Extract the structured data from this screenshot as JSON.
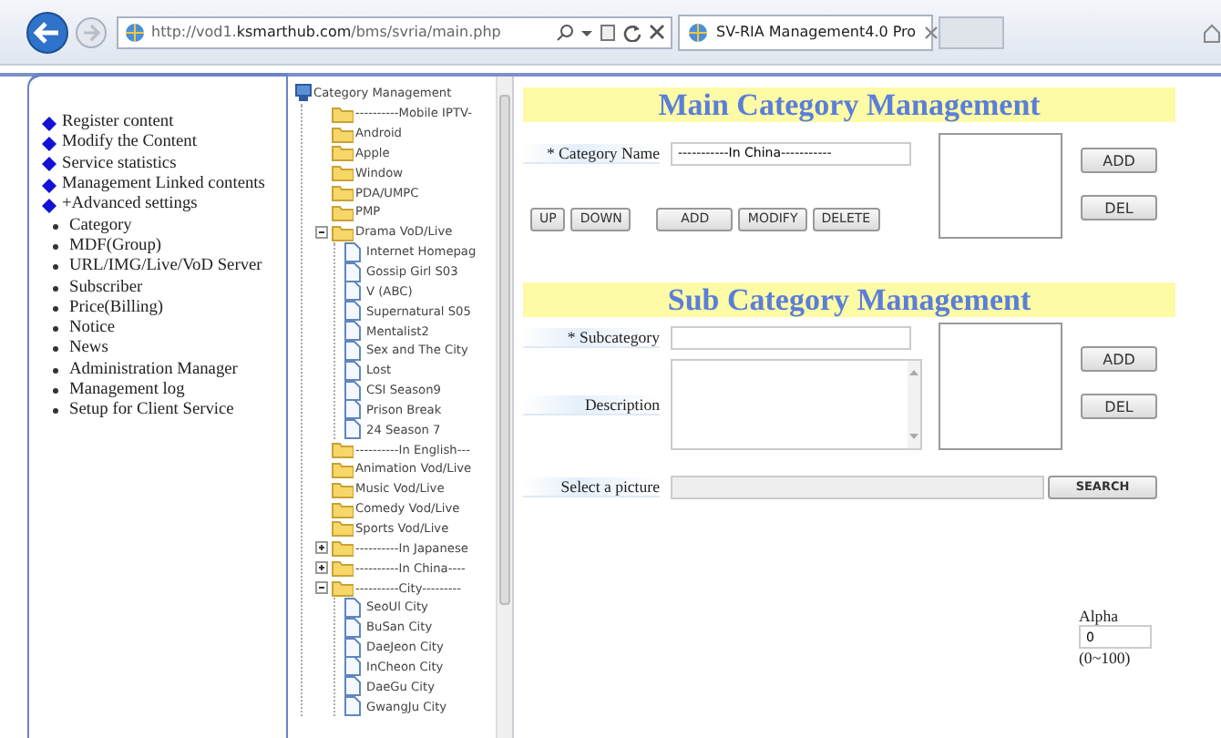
{
  "browser": {
    "url": "http://vod1.**ksmarthub.com**/bms/svria/main.php",
    "tab_title": "SV-RIA Management4.0 Pro"
  },
  "nav": {
    "main_items": [
      "Register content",
      "Modify the Content",
      "Service statistics",
      "Management Linked contents",
      "+Advanced settings"
    ],
    "sub_items": [
      "Category",
      "MDF(Group)",
      "URL/IMG/Live/VoD Server",
      "Subscriber",
      "Price(Billing)",
      "Notice",
      "News",
      "Administration Manager",
      "Management log",
      "Setup for Client Service"
    ]
  },
  "tree": {
    "root": "Category Management",
    "children": [
      {
        "label": "----------Mobile IPTV-",
        "kind": "folder"
      },
      {
        "label": "Android",
        "kind": "folder"
      },
      {
        "label": "Apple",
        "kind": "folder"
      },
      {
        "label": "Window",
        "kind": "folder"
      },
      {
        "label": "PDA/UMPC",
        "kind": "folder"
      },
      {
        "label": "PMP",
        "kind": "folder"
      },
      {
        "label": "Drama VoD/Live",
        "kind": "folder",
        "expanded": true,
        "children": [
          {
            "label": "Internet Homepag",
            "kind": "page"
          },
          {
            "label": "Gossip Girl S03",
            "kind": "page"
          },
          {
            "label": "V (ABC)",
            "kind": "page"
          },
          {
            "label": "Supernatural S05",
            "kind": "page"
          },
          {
            "label": "Mentalist2",
            "kind": "page"
          },
          {
            "label": "Sex and The City",
            "kind": "page"
          },
          {
            "label": "Lost",
            "kind": "page"
          },
          {
            "label": "CSI Season9",
            "kind": "page"
          },
          {
            "label": "Prison Break",
            "kind": "page"
          },
          {
            "label": "24 Season 7",
            "kind": "page"
          }
        ]
      },
      {
        "label": "----------In English---",
        "kind": "folder"
      },
      {
        "label": "Animation Vod/Live",
        "kind": "folder"
      },
      {
        "label": "Music Vod/Live",
        "kind": "folder"
      },
      {
        "label": "Comedy Vod/Live",
        "kind": "folder"
      },
      {
        "label": "Sports Vod/Live",
        "kind": "folder"
      },
      {
        "label": "----------In Japanese",
        "kind": "folder",
        "expanded": false
      },
      {
        "label": "----------In China----",
        "kind": "folder",
        "expanded": false
      },
      {
        "label": "----------City---------",
        "kind": "folder",
        "expanded": true,
        "children": [
          {
            "label": "SeoUl City",
            "kind": "page"
          },
          {
            "label": "BuSan City",
            "kind": "page"
          },
          {
            "label": "DaeJeon City",
            "kind": "page"
          },
          {
            "label": "InCheon City",
            "kind": "page"
          },
          {
            "label": "DaeGu City",
            "kind": "page"
          },
          {
            "label": "GwangJu City",
            "kind": "page"
          }
        ]
      }
    ]
  },
  "main_category": {
    "title": "Main Category Management",
    "name_label": "* Category Name",
    "name_value": "-----------In China-----------",
    "order_buttons": [
      "UP",
      "DOWN"
    ],
    "edit_buttons": [
      "ADD",
      "MODIFY",
      "DELETE"
    ],
    "list_buttons": [
      "ADD",
      "DEL"
    ]
  },
  "sub_category": {
    "title": "Sub Category Management",
    "subcategory_label": "* Subcategory",
    "description_label": "Description",
    "picture_label": "Select a picture",
    "search_button": "SEARCH",
    "list_buttons": [
      "ADD",
      "DEL"
    ]
  },
  "alpha": {
    "label": "Alpha",
    "value": "0",
    "range": "(0~100)"
  }
}
